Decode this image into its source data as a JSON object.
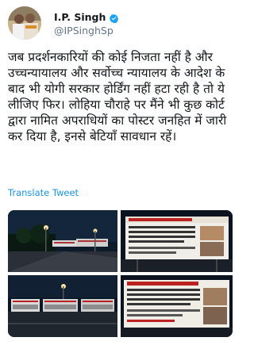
{
  "author": {
    "display_name": "I.P. Singh",
    "handle": "@IPSinghSp",
    "verified_icon": "verified-badge-icon",
    "verified_color": "#1da1f2"
  },
  "tweet": {
    "text": "जब प्रदर्शनकारियों की कोई निजता नहीं है और उच्चन्यायालय और सर्वोच्च न्यायालय के आदेश के बाद भी योगी सरकार होर्डिंग नहीं हटा रही है तो ये लीजिए फिर। लोहिया चौराहे पर मैंने भी कुछ कोर्ट द्वारा नामित अपराधियों का पोस्टर जनहित में जारी कर दिया है, इनसे बेटियाँ सावधान रहें।",
    "translate_label": "Translate Tweet",
    "link_color": "#1b95e0"
  },
  "media": [
    {
      "name": "photo-street-hoardings-night"
    },
    {
      "name": "photo-hoarding-closeup",
      "banner_text": "बेटी बचाओ इनसे"
    },
    {
      "name": "photo-hoardings-row-night"
    },
    {
      "name": "photo-hoarding-closeup-2",
      "banner_text": "बेटी बचाओ इनसे"
    }
  ]
}
